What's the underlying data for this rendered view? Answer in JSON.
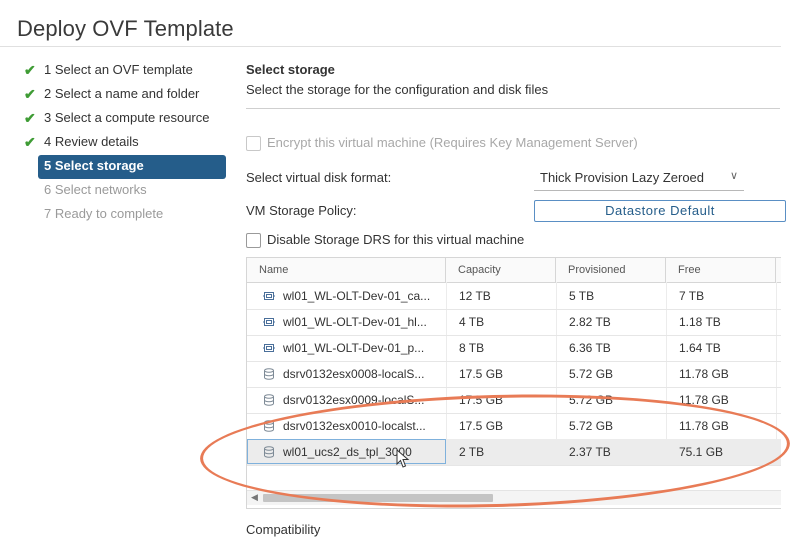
{
  "dialog": {
    "title": "Deploy OVF Template"
  },
  "steps": [
    {
      "label": "1 Select an OVF template",
      "state": "done"
    },
    {
      "label": "2 Select a name and folder",
      "state": "done"
    },
    {
      "label": "3 Select a compute resource",
      "state": "done"
    },
    {
      "label": "4 Review details",
      "state": "done"
    },
    {
      "label": "5 Select storage",
      "state": "active"
    },
    {
      "label": "6 Select networks",
      "state": "disabled"
    },
    {
      "label": "7 Ready to complete",
      "state": "disabled"
    }
  ],
  "section": {
    "title": "Select storage",
    "subtitle": "Select the storage for the configuration and disk files"
  },
  "encrypt": {
    "label": "Encrypt this virtual machine (Requires Key Management Server)",
    "checked": false
  },
  "disk_format": {
    "label": "Select virtual disk format:",
    "value": "Thick Provision Lazy Zeroed"
  },
  "storage_policy": {
    "label": "VM Storage Policy:",
    "value": "Datastore Default"
  },
  "disable_drs": {
    "label": "Disable Storage DRS for this virtual machine",
    "checked": false
  },
  "table": {
    "columns": [
      "Name",
      "Capacity",
      "Provisioned",
      "Free"
    ],
    "rows": [
      {
        "icon": "datastore-cluster-icon",
        "name": "wl01_WL-OLT-Dev-01_ca...",
        "capacity": "12 TB",
        "provisioned": "5 TB",
        "free": "7 TB"
      },
      {
        "icon": "datastore-cluster-icon",
        "name": "wl01_WL-OLT-Dev-01_hl...",
        "capacity": "4 TB",
        "provisioned": "2.82 TB",
        "free": "1.18 TB"
      },
      {
        "icon": "datastore-cluster-icon",
        "name": "wl01_WL-OLT-Dev-01_p...",
        "capacity": "8 TB",
        "provisioned": "6.36 TB",
        "free": "1.64 TB"
      },
      {
        "icon": "datastore-icon",
        "name": "dsrv0132esx0008-localS...",
        "capacity": "17.5 GB",
        "provisioned": "5.72 GB",
        "free": "11.78 GB"
      },
      {
        "icon": "datastore-icon",
        "name": "dsrv0132esx0009-localS...",
        "capacity": "17.5 GB",
        "provisioned": "5.72 GB",
        "free": "11.78 GB"
      },
      {
        "icon": "datastore-icon",
        "name": "dsrv0132esx0010-localst...",
        "capacity": "17.5 GB",
        "provisioned": "5.72 GB",
        "free": "11.78 GB"
      },
      {
        "icon": "datastore-icon",
        "name": "wl01_ucs2_ds_tpl_3000",
        "capacity": "2 TB",
        "provisioned": "2.37 TB",
        "free": "75.1 GB",
        "selected": true
      }
    ]
  },
  "compatibility": {
    "label": "Compatibility"
  },
  "colors": {
    "active_step": "#255d8a",
    "check": "#3f9c35",
    "annotation_oval": "#e87b56",
    "policy_border": "#5a8fc4"
  }
}
